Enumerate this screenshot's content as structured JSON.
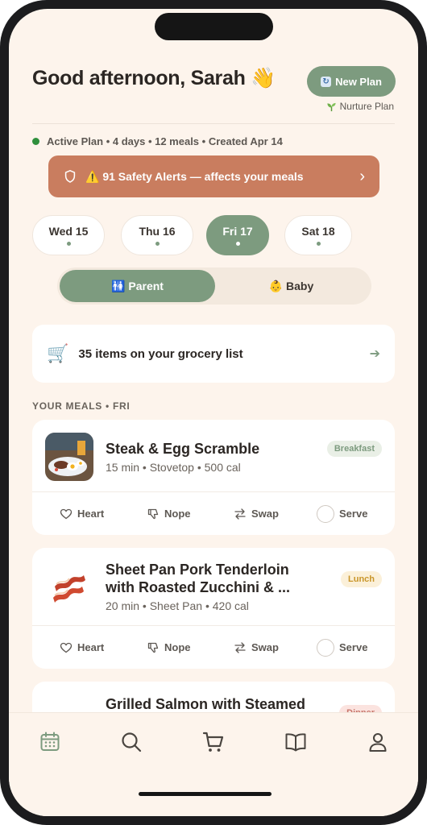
{
  "header": {
    "greeting": "Good afternoon, Sarah 👋",
    "new_plan_label": "New Plan",
    "plan_name": "Nurture Plan"
  },
  "plan": {
    "meta": "Active Plan • 4 days • 12 meals • Created Apr 14"
  },
  "alert": {
    "text": "⚠️ 91 Safety Alerts — affects your meals"
  },
  "days": [
    {
      "label": "Wed 15",
      "active": false
    },
    {
      "label": "Thu 16",
      "active": false
    },
    {
      "label": "Fri 17",
      "active": true
    },
    {
      "label": "Sat 18",
      "active": false
    }
  ],
  "segments": [
    {
      "label": "🚻 Parent",
      "active": true
    },
    {
      "label": "👶 Baby",
      "active": false
    }
  ],
  "grocery": {
    "text": "35 items on your grocery list"
  },
  "section_title": "YOUR MEALS • FRI",
  "meals": [
    {
      "name": "Steak & Egg Scramble",
      "sub": "15 min • Stovetop • 500 cal",
      "tag": "Breakfast"
    },
    {
      "name": "Sheet Pan Pork Tenderloin with Roasted Zucchini & ...",
      "sub": "20 min • Sheet Pan • 420 cal",
      "tag": "Lunch"
    },
    {
      "name": "Grilled Salmon with Steamed",
      "sub": "",
      "tag": "Dinner"
    }
  ],
  "actions": {
    "heart": "Heart",
    "nope": "Nope",
    "swap": "Swap",
    "serve": "Serve"
  },
  "colors": {
    "background": "#fdf4ec",
    "accent": "#7d9b7f",
    "alert": "#c97d5f",
    "active_dot": "#2f8f3c"
  },
  "tabs": [
    "calendar-icon",
    "search-icon",
    "cart-icon",
    "book-icon",
    "profile-icon"
  ]
}
